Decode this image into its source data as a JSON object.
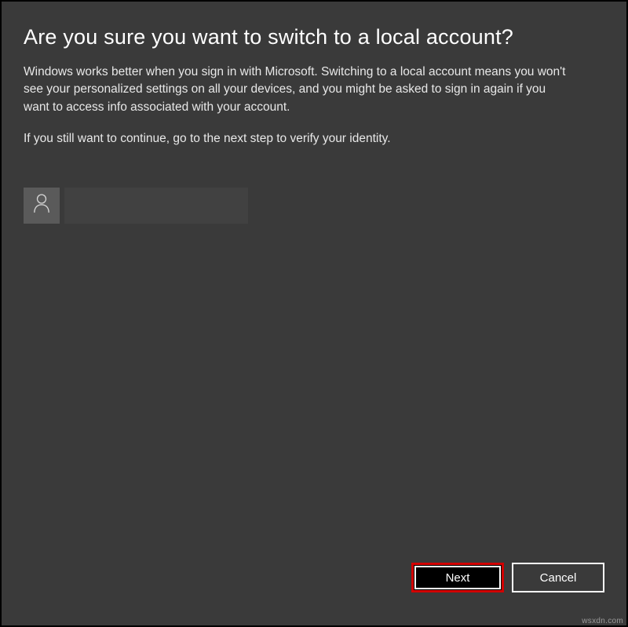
{
  "dialog": {
    "heading": "Are you sure you want to switch to a local account?",
    "paragraph1": "Windows works better when you sign in with Microsoft. Switching to a local account means you won't see your personalized settings on all your devices, and you might be asked to sign in again if you want to access info associated with your account.",
    "paragraph2": "If you still want to continue, go to the next step to verify your identity.",
    "account": {
      "icon": "person-icon",
      "label": ""
    },
    "buttons": {
      "next": "Next",
      "cancel": "Cancel"
    }
  },
  "watermark": "wsxdn.com"
}
